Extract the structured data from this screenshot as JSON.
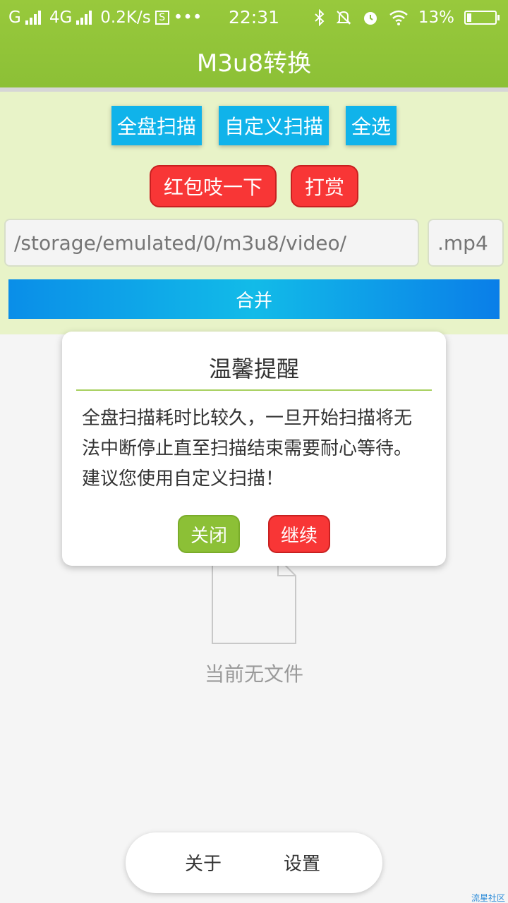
{
  "status_bar": {
    "carrier1": "G",
    "carrier2": "4G",
    "speed": "0.2K/s",
    "s_badge": "S",
    "more": "•••",
    "time": "22:31",
    "battery": "13%",
    "icons": [
      "signal-icon",
      "bluetooth-icon",
      "mute-icon",
      "alarm-icon",
      "wifi-icon",
      "battery-icon"
    ]
  },
  "app": {
    "title": "M3u8转换"
  },
  "actions": {
    "full_scan": "全盘扫描",
    "custom_scan": "自定义扫描",
    "select_all": "全选",
    "red_packet": "红包吱一下",
    "reward": "打赏"
  },
  "inputs": {
    "path_value": "/storage/emulated/0/m3u8/video/",
    "extension_value": ".mp4"
  },
  "merge": {
    "label": "合并"
  },
  "empty_state": {
    "text": "当前无文件"
  },
  "dialog": {
    "title": "温馨提醒",
    "body": "全盘扫描耗时比较久，一旦开始扫描将无法中断停止直至扫描结束需要耐心等待。建议您使用自定义扫描！",
    "close_label": "关闭",
    "continue_label": "继续"
  },
  "bottom_nav": {
    "about": "关于",
    "settings": "设置"
  },
  "watermark": "流星社区",
  "colors": {
    "header_green": "#8cc036",
    "panel_bg": "#e8f3c8",
    "blue_button": "#10b3ea",
    "red_button": "#f83636"
  }
}
